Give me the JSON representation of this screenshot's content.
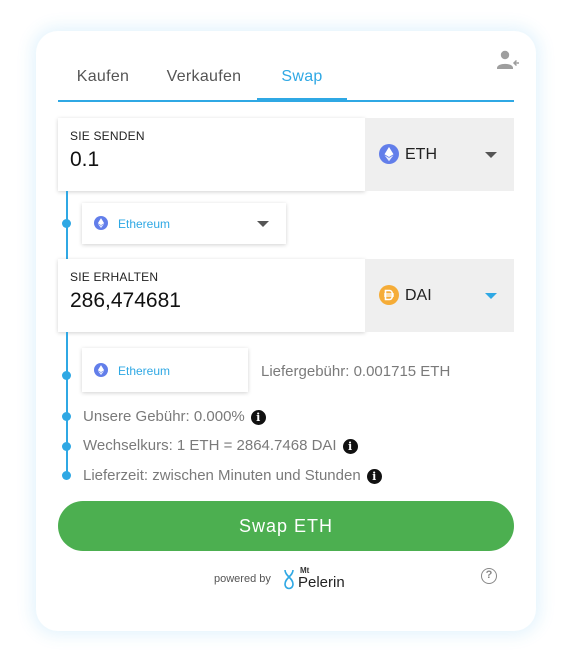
{
  "tabs": [
    {
      "label": "Kaufen"
    },
    {
      "label": "Verkaufen"
    },
    {
      "label": "Swap"
    }
  ],
  "active_tab": "Swap",
  "accent_color": "#2fa8e4",
  "button_color": "#4caf50",
  "send": {
    "label": "SIE SENDEN",
    "amount": "0.1",
    "token": "ETH",
    "token_icon": "ethereum-icon",
    "network": "Ethereum"
  },
  "receive": {
    "label": "SIE ERHALTEN",
    "amount": "286,474681",
    "token": "DAI",
    "token_icon": "dai-icon",
    "network": "Ethereum",
    "delivery_fee": "Liefergebühr: 0.001715 ETH"
  },
  "details": {
    "fee": "Unsere Gebühr: 0.000%",
    "rate": "Wechselkurs: 1 ETH = 2864.7468 DAI",
    "delivery_time": "Lieferzeit: zwischen Minuten und Stunden"
  },
  "swap_button": "Swap ETH",
  "footer": {
    "powered_by": "powered by",
    "brand_small": "Mt",
    "brand": "Pelerin"
  }
}
